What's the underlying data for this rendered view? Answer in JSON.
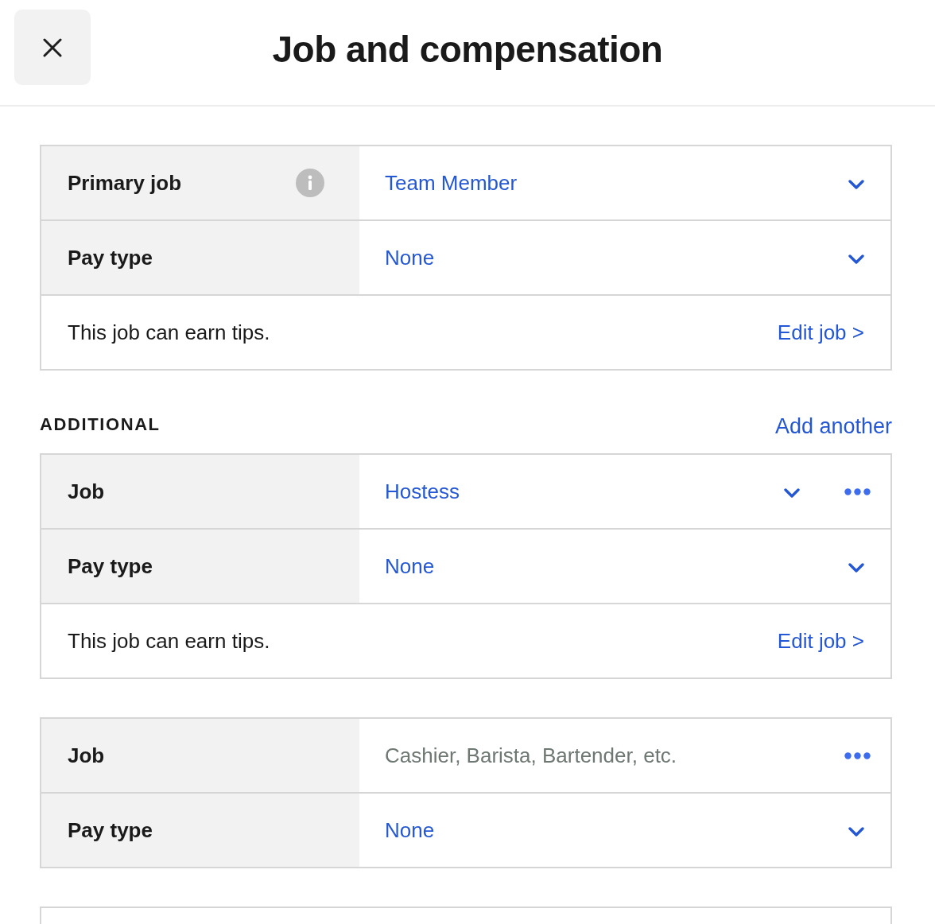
{
  "header": {
    "title": "Job and compensation"
  },
  "primary_card": {
    "rows": [
      {
        "kind": "select",
        "label": "Primary job",
        "info": true,
        "value": "Team Member",
        "menu": false
      },
      {
        "kind": "select",
        "label": "Pay type",
        "info": false,
        "value": "None",
        "menu": false
      }
    ],
    "footer": {
      "note": "This job can earn tips.",
      "link": "Edit job >"
    }
  },
  "additional": {
    "heading": "ADDITIONAL",
    "action": "Add another",
    "cards": [
      {
        "rows": [
          {
            "kind": "select",
            "label": "Job",
            "info": false,
            "value": "Hostess",
            "menu": true
          },
          {
            "kind": "select",
            "label": "Pay type",
            "info": false,
            "value": "None",
            "menu": false
          }
        ],
        "footer": {
          "note": "This job can earn tips.",
          "link": "Edit job >"
        }
      },
      {
        "rows": [
          {
            "kind": "input",
            "label": "Job",
            "info": false,
            "placeholder": "Cashier, Barista, Bartender, etc.",
            "menu": true
          },
          {
            "kind": "select",
            "label": "Pay type",
            "info": false,
            "value": "None",
            "menu": false
          }
        ]
      }
    ]
  }
}
